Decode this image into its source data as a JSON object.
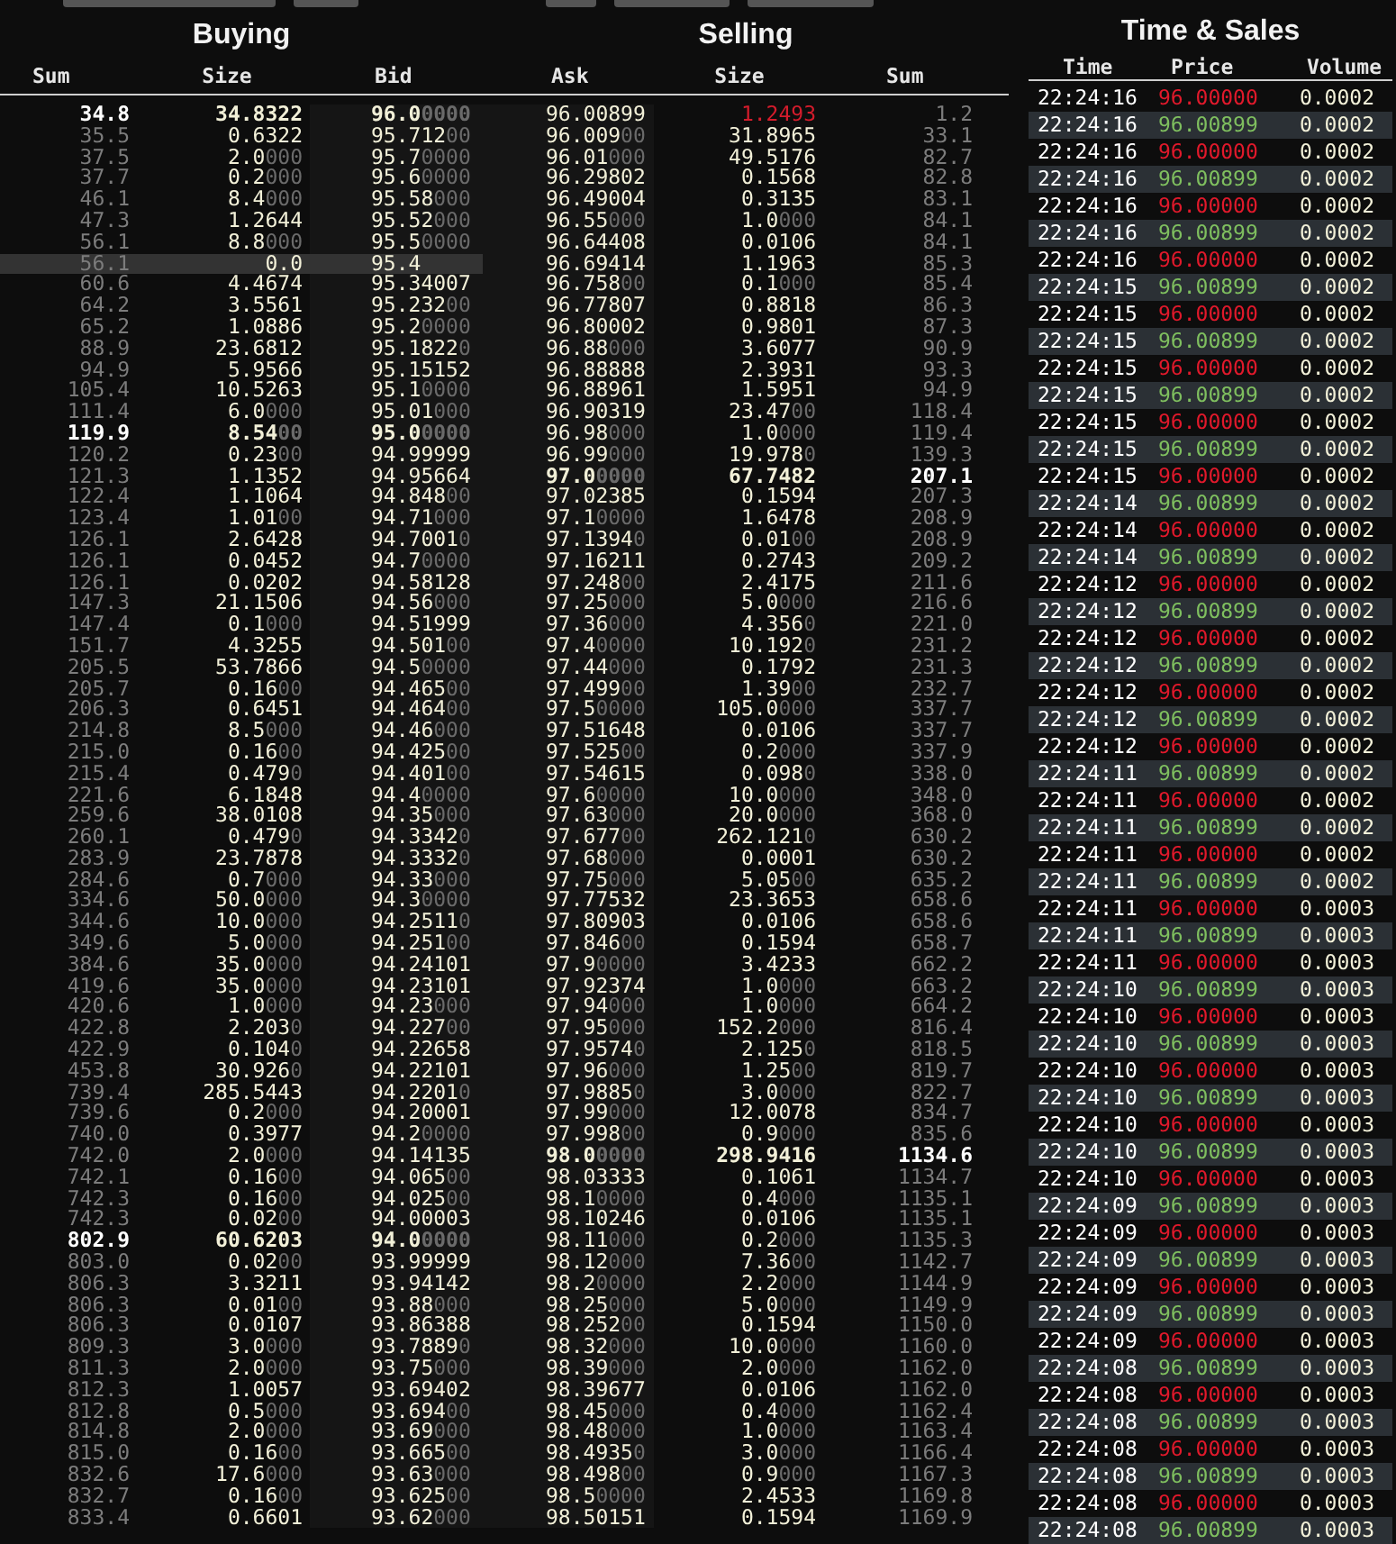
{
  "buying": {
    "title": "Buying",
    "columns": [
      "Sum",
      "Size",
      "Bid"
    ],
    "rows": [
      {
        "sum": "34.8",
        "size": "34.8322",
        "bid": "96.00000",
        "bold": true,
        "hovered": false
      },
      {
        "sum": "35.5",
        "size": "0.6322",
        "bid": "95.71200",
        "bold": false,
        "hovered": false
      },
      {
        "sum": "37.5",
        "size": "2.0000",
        "bid": "95.70000",
        "bold": false,
        "hovered": false
      },
      {
        "sum": "37.7",
        "size": "0.2000",
        "bid": "95.60000",
        "bold": false,
        "hovered": false
      },
      {
        "sum": "46.1",
        "size": "8.4000",
        "bid": "95.58000",
        "bold": false,
        "hovered": false
      },
      {
        "sum": "47.3",
        "size": "1.2644",
        "bid": "95.52000",
        "bold": false,
        "hovered": false
      },
      {
        "sum": "56.1",
        "size": "8.8000",
        "bid": "95.50000",
        "bold": false,
        "hovered": false
      },
      {
        "sum": "56.1",
        "size": "0.0",
        "bid": "95.4",
        "bold": false,
        "hovered": true
      },
      {
        "sum": "60.6",
        "size": "4.4674",
        "bid": "95.34007",
        "bold": false,
        "hovered": false
      },
      {
        "sum": "64.2",
        "size": "3.5561",
        "bid": "95.23200",
        "bold": false,
        "hovered": false
      },
      {
        "sum": "65.2",
        "size": "1.0886",
        "bid": "95.20000",
        "bold": false,
        "hovered": false
      },
      {
        "sum": "88.9",
        "size": "23.6812",
        "bid": "95.18220",
        "bold": false,
        "hovered": false
      },
      {
        "sum": "94.9",
        "size": "5.9566",
        "bid": "95.15152",
        "bold": false,
        "hovered": false
      },
      {
        "sum": "105.4",
        "size": "10.5263",
        "bid": "95.10000",
        "bold": false,
        "hovered": false
      },
      {
        "sum": "111.4",
        "size": "6.0000",
        "bid": "95.01000",
        "bold": false,
        "hovered": false
      },
      {
        "sum": "119.9",
        "size": "8.5400",
        "bid": "95.00000",
        "bold": true,
        "hovered": false
      },
      {
        "sum": "120.2",
        "size": "0.2300",
        "bid": "94.99999",
        "bold": false,
        "hovered": false
      },
      {
        "sum": "121.3",
        "size": "1.1352",
        "bid": "94.95664",
        "bold": false,
        "hovered": false
      },
      {
        "sum": "122.4",
        "size": "1.1064",
        "bid": "94.84800",
        "bold": false,
        "hovered": false
      },
      {
        "sum": "123.4",
        "size": "1.0100",
        "bid": "94.71000",
        "bold": false,
        "hovered": false
      },
      {
        "sum": "126.1",
        "size": "2.6428",
        "bid": "94.70010",
        "bold": false,
        "hovered": false
      },
      {
        "sum": "126.1",
        "size": "0.0452",
        "bid": "94.70000",
        "bold": false,
        "hovered": false
      },
      {
        "sum": "126.1",
        "size": "0.0202",
        "bid": "94.58128",
        "bold": false,
        "hovered": false
      },
      {
        "sum": "147.3",
        "size": "21.1506",
        "bid": "94.56000",
        "bold": false,
        "hovered": false
      },
      {
        "sum": "147.4",
        "size": "0.1000",
        "bid": "94.51999",
        "bold": false,
        "hovered": false
      },
      {
        "sum": "151.7",
        "size": "4.3255",
        "bid": "94.50100",
        "bold": false,
        "hovered": false
      },
      {
        "sum": "205.5",
        "size": "53.7866",
        "bid": "94.50000",
        "bold": false,
        "hovered": false
      },
      {
        "sum": "205.7",
        "size": "0.1600",
        "bid": "94.46500",
        "bold": false,
        "hovered": false
      },
      {
        "sum": "206.3",
        "size": "0.6451",
        "bid": "94.46400",
        "bold": false,
        "hovered": false
      },
      {
        "sum": "214.8",
        "size": "8.5000",
        "bid": "94.46000",
        "bold": false,
        "hovered": false
      },
      {
        "sum": "215.0",
        "size": "0.1600",
        "bid": "94.42500",
        "bold": false,
        "hovered": false
      },
      {
        "sum": "215.4",
        "size": "0.4790",
        "bid": "94.40100",
        "bold": false,
        "hovered": false
      },
      {
        "sum": "221.6",
        "size": "6.1848",
        "bid": "94.40000",
        "bold": false,
        "hovered": false
      },
      {
        "sum": "259.6",
        "size": "38.0108",
        "bid": "94.35000",
        "bold": false,
        "hovered": false
      },
      {
        "sum": "260.1",
        "size": "0.4790",
        "bid": "94.33420",
        "bold": false,
        "hovered": false
      },
      {
        "sum": "283.9",
        "size": "23.7878",
        "bid": "94.33320",
        "bold": false,
        "hovered": false
      },
      {
        "sum": "284.6",
        "size": "0.7000",
        "bid": "94.33000",
        "bold": false,
        "hovered": false
      },
      {
        "sum": "334.6",
        "size": "50.0000",
        "bid": "94.30000",
        "bold": false,
        "hovered": false
      },
      {
        "sum": "344.6",
        "size": "10.0000",
        "bid": "94.25110",
        "bold": false,
        "hovered": false
      },
      {
        "sum": "349.6",
        "size": "5.0000",
        "bid": "94.25100",
        "bold": false,
        "hovered": false
      },
      {
        "sum": "384.6",
        "size": "35.0000",
        "bid": "94.24101",
        "bold": false,
        "hovered": false
      },
      {
        "sum": "419.6",
        "size": "35.0000",
        "bid": "94.23101",
        "bold": false,
        "hovered": false
      },
      {
        "sum": "420.6",
        "size": "1.0000",
        "bid": "94.23000",
        "bold": false,
        "hovered": false
      },
      {
        "sum": "422.8",
        "size": "2.2030",
        "bid": "94.22700",
        "bold": false,
        "hovered": false
      },
      {
        "sum": "422.9",
        "size": "0.1040",
        "bid": "94.22658",
        "bold": false,
        "hovered": false
      },
      {
        "sum": "453.8",
        "size": "30.9260",
        "bid": "94.22101",
        "bold": false,
        "hovered": false
      },
      {
        "sum": "739.4",
        "size": "285.5443",
        "bid": "94.22010",
        "bold": false,
        "hovered": false
      },
      {
        "sum": "739.6",
        "size": "0.2000",
        "bid": "94.20001",
        "bold": false,
        "hovered": false
      },
      {
        "sum": "740.0",
        "size": "0.3977",
        "bid": "94.20000",
        "bold": false,
        "hovered": false
      },
      {
        "sum": "742.0",
        "size": "2.0000",
        "bid": "94.14135",
        "bold": false,
        "hovered": false
      },
      {
        "sum": "742.1",
        "size": "0.1600",
        "bid": "94.06500",
        "bold": false,
        "hovered": false
      },
      {
        "sum": "742.3",
        "size": "0.1600",
        "bid": "94.02500",
        "bold": false,
        "hovered": false
      },
      {
        "sum": "742.3",
        "size": "0.0200",
        "bid": "94.00003",
        "bold": false,
        "hovered": false
      },
      {
        "sum": "802.9",
        "size": "60.6203",
        "bid": "94.00000",
        "bold": true,
        "hovered": false
      },
      {
        "sum": "803.0",
        "size": "0.0200",
        "bid": "93.99999",
        "bold": false,
        "hovered": false
      },
      {
        "sum": "806.3",
        "size": "3.3211",
        "bid": "93.94142",
        "bold": false,
        "hovered": false
      },
      {
        "sum": "806.3",
        "size": "0.0100",
        "bid": "93.88000",
        "bold": false,
        "hovered": false
      },
      {
        "sum": "806.3",
        "size": "0.0107",
        "bid": "93.86388",
        "bold": false,
        "hovered": false
      },
      {
        "sum": "809.3",
        "size": "3.0000",
        "bid": "93.78890",
        "bold": false,
        "hovered": false
      },
      {
        "sum": "811.3",
        "size": "2.0000",
        "bid": "93.75000",
        "bold": false,
        "hovered": false
      },
      {
        "sum": "812.3",
        "size": "1.0057",
        "bid": "93.69402",
        "bold": false,
        "hovered": false
      },
      {
        "sum": "812.8",
        "size": "0.5000",
        "bid": "93.69400",
        "bold": false,
        "hovered": false
      },
      {
        "sum": "814.8",
        "size": "2.0000",
        "bid": "93.69000",
        "bold": false,
        "hovered": false
      },
      {
        "sum": "815.0",
        "size": "0.1600",
        "bid": "93.66500",
        "bold": false,
        "hovered": false
      },
      {
        "sum": "832.6",
        "size": "17.6000",
        "bid": "93.63000",
        "bold": false,
        "hovered": false
      },
      {
        "sum": "832.7",
        "size": "0.1600",
        "bid": "93.62500",
        "bold": false,
        "hovered": false
      },
      {
        "sum": "833.4",
        "size": "0.6601",
        "bid": "93.62000",
        "bold": false,
        "hovered": false
      }
    ]
  },
  "selling": {
    "title": "Selling",
    "columns": [
      "Ask",
      "Size",
      "Sum"
    ],
    "rows": [
      {
        "ask": "96.00899",
        "size": "1.2493",
        "sum": "1.2",
        "bold": false,
        "flash": true
      },
      {
        "ask": "96.00900",
        "size": "31.8965",
        "sum": "33.1",
        "bold": false,
        "flash": false
      },
      {
        "ask": "96.01000",
        "size": "49.5176",
        "sum": "82.7",
        "bold": false,
        "flash": false
      },
      {
        "ask": "96.29802",
        "size": "0.1568",
        "sum": "82.8",
        "bold": false,
        "flash": false
      },
      {
        "ask": "96.49004",
        "size": "0.3135",
        "sum": "83.1",
        "bold": false,
        "flash": false
      },
      {
        "ask": "96.55000",
        "size": "1.0000",
        "sum": "84.1",
        "bold": false,
        "flash": false
      },
      {
        "ask": "96.64408",
        "size": "0.0106",
        "sum": "84.1",
        "bold": false,
        "flash": false
      },
      {
        "ask": "96.69414",
        "size": "1.1963",
        "sum": "85.3",
        "bold": false,
        "flash": false
      },
      {
        "ask": "96.75800",
        "size": "0.1000",
        "sum": "85.4",
        "bold": false,
        "flash": false
      },
      {
        "ask": "96.77807",
        "size": "0.8818",
        "sum": "86.3",
        "bold": false,
        "flash": false
      },
      {
        "ask": "96.80002",
        "size": "0.9801",
        "sum": "87.3",
        "bold": false,
        "flash": false
      },
      {
        "ask": "96.88000",
        "size": "3.6077",
        "sum": "90.9",
        "bold": false,
        "flash": false
      },
      {
        "ask": "96.88888",
        "size": "2.3931",
        "sum": "93.3",
        "bold": false,
        "flash": false
      },
      {
        "ask": "96.88961",
        "size": "1.5951",
        "sum": "94.9",
        "bold": false,
        "flash": false
      },
      {
        "ask": "96.90319",
        "size": "23.4700",
        "sum": "118.4",
        "bold": false,
        "flash": false
      },
      {
        "ask": "96.98000",
        "size": "1.0000",
        "sum": "119.4",
        "bold": false,
        "flash": false
      },
      {
        "ask": "96.99000",
        "size": "19.9780",
        "sum": "139.3",
        "bold": false,
        "flash": false
      },
      {
        "ask": "97.00000",
        "size": "67.7482",
        "sum": "207.1",
        "bold": true,
        "flash": false
      },
      {
        "ask": "97.02385",
        "size": "0.1594",
        "sum": "207.3",
        "bold": false,
        "flash": false
      },
      {
        "ask": "97.10000",
        "size": "1.6478",
        "sum": "208.9",
        "bold": false,
        "flash": false
      },
      {
        "ask": "97.13940",
        "size": "0.0100",
        "sum": "208.9",
        "bold": false,
        "flash": false
      },
      {
        "ask": "97.16211",
        "size": "0.2743",
        "sum": "209.2",
        "bold": false,
        "flash": false
      },
      {
        "ask": "97.24800",
        "size": "2.4175",
        "sum": "211.6",
        "bold": false,
        "flash": false
      },
      {
        "ask": "97.25000",
        "size": "5.0000",
        "sum": "216.6",
        "bold": false,
        "flash": false
      },
      {
        "ask": "97.36000",
        "size": "4.3560",
        "sum": "221.0",
        "bold": false,
        "flash": false
      },
      {
        "ask": "97.40000",
        "size": "10.1920",
        "sum": "231.2",
        "bold": false,
        "flash": false
      },
      {
        "ask": "97.44000",
        "size": "0.1792",
        "sum": "231.3",
        "bold": false,
        "flash": false
      },
      {
        "ask": "97.49900",
        "size": "1.3900",
        "sum": "232.7",
        "bold": false,
        "flash": false
      },
      {
        "ask": "97.50000",
        "size": "105.0000",
        "sum": "337.7",
        "bold": false,
        "flash": false
      },
      {
        "ask": "97.51648",
        "size": "0.0106",
        "sum": "337.7",
        "bold": false,
        "flash": false
      },
      {
        "ask": "97.52500",
        "size": "0.2000",
        "sum": "337.9",
        "bold": false,
        "flash": false
      },
      {
        "ask": "97.54615",
        "size": "0.0980",
        "sum": "338.0",
        "bold": false,
        "flash": false
      },
      {
        "ask": "97.60000",
        "size": "10.0000",
        "sum": "348.0",
        "bold": false,
        "flash": false
      },
      {
        "ask": "97.63000",
        "size": "20.0000",
        "sum": "368.0",
        "bold": false,
        "flash": false
      },
      {
        "ask": "97.67700",
        "size": "262.1210",
        "sum": "630.2",
        "bold": false,
        "flash": false
      },
      {
        "ask": "97.68000",
        "size": "0.0001",
        "sum": "630.2",
        "bold": false,
        "flash": false
      },
      {
        "ask": "97.75000",
        "size": "5.0500",
        "sum": "635.2",
        "bold": false,
        "flash": false
      },
      {
        "ask": "97.77532",
        "size": "23.3653",
        "sum": "658.6",
        "bold": false,
        "flash": false
      },
      {
        "ask": "97.80903",
        "size": "0.0106",
        "sum": "658.6",
        "bold": false,
        "flash": false
      },
      {
        "ask": "97.84600",
        "size": "0.1594",
        "sum": "658.7",
        "bold": false,
        "flash": false
      },
      {
        "ask": "97.90000",
        "size": "3.4233",
        "sum": "662.2",
        "bold": false,
        "flash": false
      },
      {
        "ask": "97.92374",
        "size": "1.0000",
        "sum": "663.2",
        "bold": false,
        "flash": false
      },
      {
        "ask": "97.94000",
        "size": "1.0000",
        "sum": "664.2",
        "bold": false,
        "flash": false
      },
      {
        "ask": "97.95000",
        "size": "152.2000",
        "sum": "816.4",
        "bold": false,
        "flash": false
      },
      {
        "ask": "97.95740",
        "size": "2.1250",
        "sum": "818.5",
        "bold": false,
        "flash": false
      },
      {
        "ask": "97.96000",
        "size": "1.2500",
        "sum": "819.7",
        "bold": false,
        "flash": false
      },
      {
        "ask": "97.98850",
        "size": "3.0000",
        "sum": "822.7",
        "bold": false,
        "flash": false
      },
      {
        "ask": "97.99000",
        "size": "12.0078",
        "sum": "834.7",
        "bold": false,
        "flash": false
      },
      {
        "ask": "97.99800",
        "size": "0.9000",
        "sum": "835.6",
        "bold": false,
        "flash": false
      },
      {
        "ask": "98.00000",
        "size": "298.9416",
        "sum": "1134.6",
        "bold": true,
        "flash": false
      },
      {
        "ask": "98.03333",
        "size": "0.1061",
        "sum": "1134.7",
        "bold": false,
        "flash": false
      },
      {
        "ask": "98.10000",
        "size": "0.4000",
        "sum": "1135.1",
        "bold": false,
        "flash": false
      },
      {
        "ask": "98.10246",
        "size": "0.0106",
        "sum": "1135.1",
        "bold": false,
        "flash": false
      },
      {
        "ask": "98.11000",
        "size": "0.2000",
        "sum": "1135.3",
        "bold": false,
        "flash": false
      },
      {
        "ask": "98.12000",
        "size": "7.3600",
        "sum": "1142.7",
        "bold": false,
        "flash": false
      },
      {
        "ask": "98.20000",
        "size": "2.2000",
        "sum": "1144.9",
        "bold": false,
        "flash": false
      },
      {
        "ask": "98.25000",
        "size": "5.0000",
        "sum": "1149.9",
        "bold": false,
        "flash": false
      },
      {
        "ask": "98.25200",
        "size": "0.1594",
        "sum": "1150.0",
        "bold": false,
        "flash": false
      },
      {
        "ask": "98.32000",
        "size": "10.0000",
        "sum": "1160.0",
        "bold": false,
        "flash": false
      },
      {
        "ask": "98.39000",
        "size": "2.0000",
        "sum": "1162.0",
        "bold": false,
        "flash": false
      },
      {
        "ask": "98.39677",
        "size": "0.0106",
        "sum": "1162.0",
        "bold": false,
        "flash": false
      },
      {
        "ask": "98.45000",
        "size": "0.4000",
        "sum": "1162.4",
        "bold": false,
        "flash": false
      },
      {
        "ask": "98.48000",
        "size": "1.0000",
        "sum": "1163.4",
        "bold": false,
        "flash": false
      },
      {
        "ask": "98.49350",
        "size": "3.0000",
        "sum": "1166.4",
        "bold": false,
        "flash": false
      },
      {
        "ask": "98.49800",
        "size": "0.9000",
        "sum": "1167.3",
        "bold": false,
        "flash": false
      },
      {
        "ask": "98.50000",
        "size": "2.4533",
        "sum": "1169.8",
        "bold": false,
        "flash": false
      },
      {
        "ask": "98.50151",
        "size": "0.1594",
        "sum": "1169.9",
        "bold": false,
        "flash": false
      }
    ]
  },
  "time_sales": {
    "title": "Time & Sales",
    "columns": [
      "Time",
      "Price",
      "Volume"
    ],
    "rows": [
      {
        "time": "22:24:16",
        "price": "96.00000",
        "volume": "0.0002",
        "kind": "down"
      },
      {
        "time": "22:24:16",
        "price": "96.00899",
        "volume": "0.0002",
        "kind": "up"
      },
      {
        "time": "22:24:16",
        "price": "96.00000",
        "volume": "0.0002",
        "kind": "down"
      },
      {
        "time": "22:24:16",
        "price": "96.00899",
        "volume": "0.0002",
        "kind": "up"
      },
      {
        "time": "22:24:16",
        "price": "96.00000",
        "volume": "0.0002",
        "kind": "down"
      },
      {
        "time": "22:24:16",
        "price": "96.00899",
        "volume": "0.0002",
        "kind": "up"
      },
      {
        "time": "22:24:16",
        "price": "96.00000",
        "volume": "0.0002",
        "kind": "down"
      },
      {
        "time": "22:24:15",
        "price": "96.00899",
        "volume": "0.0002",
        "kind": "up"
      },
      {
        "time": "22:24:15",
        "price": "96.00000",
        "volume": "0.0002",
        "kind": "down"
      },
      {
        "time": "22:24:15",
        "price": "96.00899",
        "volume": "0.0002",
        "kind": "up"
      },
      {
        "time": "22:24:15",
        "price": "96.00000",
        "volume": "0.0002",
        "kind": "down"
      },
      {
        "time": "22:24:15",
        "price": "96.00899",
        "volume": "0.0002",
        "kind": "up"
      },
      {
        "time": "22:24:15",
        "price": "96.00000",
        "volume": "0.0002",
        "kind": "down"
      },
      {
        "time": "22:24:15",
        "price": "96.00899",
        "volume": "0.0002",
        "kind": "up"
      },
      {
        "time": "22:24:15",
        "price": "96.00000",
        "volume": "0.0002",
        "kind": "down"
      },
      {
        "time": "22:24:14",
        "price": "96.00899",
        "volume": "0.0002",
        "kind": "up"
      },
      {
        "time": "22:24:14",
        "price": "96.00000",
        "volume": "0.0002",
        "kind": "down"
      },
      {
        "time": "22:24:14",
        "price": "96.00899",
        "volume": "0.0002",
        "kind": "up"
      },
      {
        "time": "22:24:12",
        "price": "96.00000",
        "volume": "0.0002",
        "kind": "down"
      },
      {
        "time": "22:24:12",
        "price": "96.00899",
        "volume": "0.0002",
        "kind": "up"
      },
      {
        "time": "22:24:12",
        "price": "96.00000",
        "volume": "0.0002",
        "kind": "down"
      },
      {
        "time": "22:24:12",
        "price": "96.00899",
        "volume": "0.0002",
        "kind": "up"
      },
      {
        "time": "22:24:12",
        "price": "96.00000",
        "volume": "0.0002",
        "kind": "down"
      },
      {
        "time": "22:24:12",
        "price": "96.00899",
        "volume": "0.0002",
        "kind": "up"
      },
      {
        "time": "22:24:12",
        "price": "96.00000",
        "volume": "0.0002",
        "kind": "down"
      },
      {
        "time": "22:24:11",
        "price": "96.00899",
        "volume": "0.0002",
        "kind": "up"
      },
      {
        "time": "22:24:11",
        "price": "96.00000",
        "volume": "0.0002",
        "kind": "down"
      },
      {
        "time": "22:24:11",
        "price": "96.00899",
        "volume": "0.0002",
        "kind": "up"
      },
      {
        "time": "22:24:11",
        "price": "96.00000",
        "volume": "0.0002",
        "kind": "down"
      },
      {
        "time": "22:24:11",
        "price": "96.00899",
        "volume": "0.0002",
        "kind": "up"
      },
      {
        "time": "22:24:11",
        "price": "96.00000",
        "volume": "0.0003",
        "kind": "down"
      },
      {
        "time": "22:24:11",
        "price": "96.00899",
        "volume": "0.0003",
        "kind": "up"
      },
      {
        "time": "22:24:11",
        "price": "96.00000",
        "volume": "0.0003",
        "kind": "down"
      },
      {
        "time": "22:24:10",
        "price": "96.00899",
        "volume": "0.0003",
        "kind": "up"
      },
      {
        "time": "22:24:10",
        "price": "96.00000",
        "volume": "0.0003",
        "kind": "down"
      },
      {
        "time": "22:24:10",
        "price": "96.00899",
        "volume": "0.0003",
        "kind": "up"
      },
      {
        "time": "22:24:10",
        "price": "96.00000",
        "volume": "0.0003",
        "kind": "down"
      },
      {
        "time": "22:24:10",
        "price": "96.00899",
        "volume": "0.0003",
        "kind": "up"
      },
      {
        "time": "22:24:10",
        "price": "96.00000",
        "volume": "0.0003",
        "kind": "down"
      },
      {
        "time": "22:24:10",
        "price": "96.00899",
        "volume": "0.0003",
        "kind": "up"
      },
      {
        "time": "22:24:10",
        "price": "96.00000",
        "volume": "0.0003",
        "kind": "down"
      },
      {
        "time": "22:24:09",
        "price": "96.00899",
        "volume": "0.0003",
        "kind": "up"
      },
      {
        "time": "22:24:09",
        "price": "96.00000",
        "volume": "0.0003",
        "kind": "down"
      },
      {
        "time": "22:24:09",
        "price": "96.00899",
        "volume": "0.0003",
        "kind": "up"
      },
      {
        "time": "22:24:09",
        "price": "96.00000",
        "volume": "0.0003",
        "kind": "down"
      },
      {
        "time": "22:24:09",
        "price": "96.00899",
        "volume": "0.0003",
        "kind": "up"
      },
      {
        "time": "22:24:09",
        "price": "96.00000",
        "volume": "0.0003",
        "kind": "down"
      },
      {
        "time": "22:24:08",
        "price": "96.00899",
        "volume": "0.0003",
        "kind": "up"
      },
      {
        "time": "22:24:08",
        "price": "96.00000",
        "volume": "0.0003",
        "kind": "down"
      },
      {
        "time": "22:24:08",
        "price": "96.00899",
        "volume": "0.0003",
        "kind": "up"
      },
      {
        "time": "22:24:08",
        "price": "96.00000",
        "volume": "0.0003",
        "kind": "down"
      },
      {
        "time": "22:24:08",
        "price": "96.00899",
        "volume": "0.0003",
        "kind": "up"
      },
      {
        "time": "22:24:08",
        "price": "96.00000",
        "volume": "0.0003",
        "kind": "down"
      },
      {
        "time": "22:24:08",
        "price": "96.00899",
        "volume": "0.0003",
        "kind": "up"
      }
    ]
  }
}
